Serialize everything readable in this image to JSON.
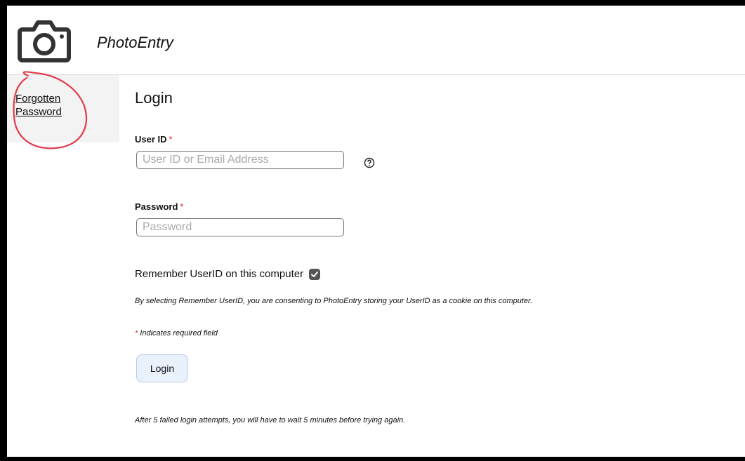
{
  "header": {
    "logo_icon": "camera-icon",
    "app_name": "PhotoEntry"
  },
  "sidebar": {
    "forgot_password": "Forgotten Password",
    "annotation_color": "#e23b4a"
  },
  "form": {
    "title": "Login",
    "userid": {
      "label": "User ID",
      "required_mark": "*",
      "placeholder": "User ID or Email Address",
      "value": "",
      "help_icon": "question-circle-icon"
    },
    "password": {
      "label": "Password",
      "required_mark": "*",
      "placeholder": "Password",
      "value": ""
    },
    "remember": {
      "label": "Remember UserID on this computer",
      "checked": true
    },
    "consent_note": "By selecting Remember UserID, you are consenting to PhotoEntry storing your UserID as a cookie on this computer.",
    "required_note_mark": "*",
    "required_note": "Indicates required field",
    "login_button": "Login",
    "lockout_note": "After 5 failed login attempts, you will have to wait 5 minutes before trying again."
  },
  "colors": {
    "required": "#d0312d",
    "button_bg": "#e9f1fb",
    "checkbox": "#555555"
  }
}
